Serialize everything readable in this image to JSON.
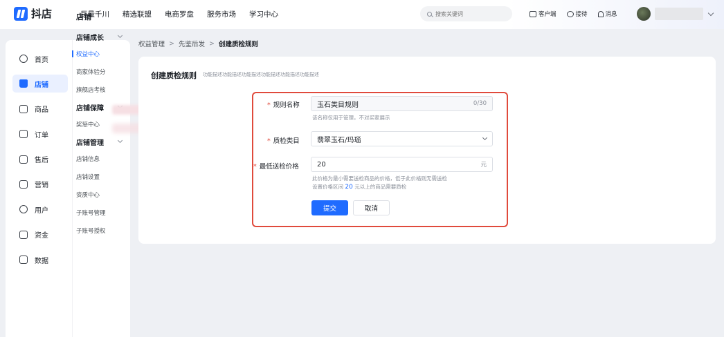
{
  "app": {
    "name": "抖店"
  },
  "topnav": [
    "巨量千川",
    "精选联盟",
    "电商罗盘",
    "服务市场",
    "学习中心"
  ],
  "search": {
    "placeholder": "搜索关键词"
  },
  "topright": {
    "client": "客户端",
    "reception": "接待",
    "messages": "消息"
  },
  "nav1": [
    "首页",
    "店铺",
    "商品",
    "订单",
    "售后",
    "营销",
    "用户",
    "资金",
    "数据"
  ],
  "nav2": {
    "title": "店铺",
    "groups": [
      {
        "label": "店铺成长",
        "items": [
          "权益中心",
          "商家体验分",
          "旗舰店考核"
        ]
      },
      {
        "label": "店铺保障",
        "items": [
          "奖惩中心"
        ]
      },
      {
        "label": "店铺管理",
        "items": [
          "店铺信息",
          "店铺设置",
          "资质中心",
          "子账号管理",
          "子账号授权"
        ]
      }
    ]
  },
  "breadcrumb": [
    "权益管理",
    "先鉴后发",
    "创建质检规则"
  ],
  "page": {
    "title": "创建质检规则",
    "description": "功能描述功能描述功能描述功能描述功能描述功能描述"
  },
  "form": {
    "rule_name": {
      "label": "规则名称",
      "value": "玉石类目规则",
      "counter": "0/30",
      "hint": "该名称仅用于管理，不对买家展示"
    },
    "category": {
      "label": "质检类目",
      "value": "翡翠玉石/玛瑙"
    },
    "min_price": {
      "label": "最低送检价格",
      "value": "20",
      "unit": "元",
      "hint_line1": "此价格为最小需要送检商品的价格，低于此价格则无需送检",
      "hint_prefix": "设置价格区间",
      "hint_value": "20",
      "hint_suffix": "元以上的商品需要质检"
    },
    "submit": "提交",
    "cancel": "取消"
  },
  "colors": {
    "accent": "#1f6bff",
    "highlight_border": "#e04a3c",
    "required": "#e04a3c"
  }
}
